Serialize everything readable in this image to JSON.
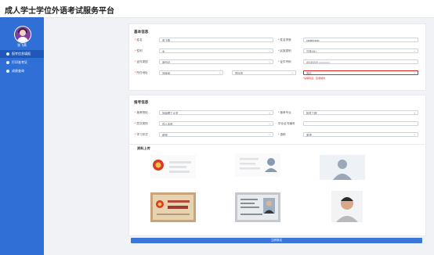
{
  "header": {
    "title": "成人学士学位外语考试服务平台"
  },
  "sidebar": {
    "username": "张飞燕",
    "items": [
      {
        "label": "报考信息填报"
      },
      {
        "label": "打印准考证"
      },
      {
        "label": "成绩查询"
      }
    ]
  },
  "basic": {
    "title": "基本信息",
    "name_label": "姓名",
    "name_value": "张飞燕",
    "pinyin_label": "姓名拼音",
    "pinyin_value": "yanfeizang",
    "gender_label": "性别",
    "gender_value": "女",
    "nation_label": "民族类别",
    "nation_value": "汉族(01)",
    "idtype_label": "证件类型",
    "idtype_value": "身份证",
    "idno_label": "证件号码",
    "idno_value": "41132219",
    "addr_label": "所在地址",
    "province_value": "河南省",
    "city_value": "郑州市",
    "district_value": "市区",
    "addr_error": "*请填写县、区或城市"
  },
  "exam": {
    "title": "报考信息",
    "school_label": "报考院校",
    "school_value": "河南理工大学",
    "major_label": "报考专业",
    "major_value": "软件工程",
    "level_label": "层次类别",
    "level_value": "成人本科",
    "cert_label": "毕业证书编号",
    "cert_value": "",
    "mode_label": "学习形式",
    "mode_value": "函授",
    "lang_label": "语种",
    "lang_value": "英语"
  },
  "upload": {
    "title": "资料上传"
  },
  "submit_label": "立即报名",
  "colors": {
    "sidebar": "#2f6fd6",
    "submit": "#3b76d9",
    "error": "#e02020"
  }
}
